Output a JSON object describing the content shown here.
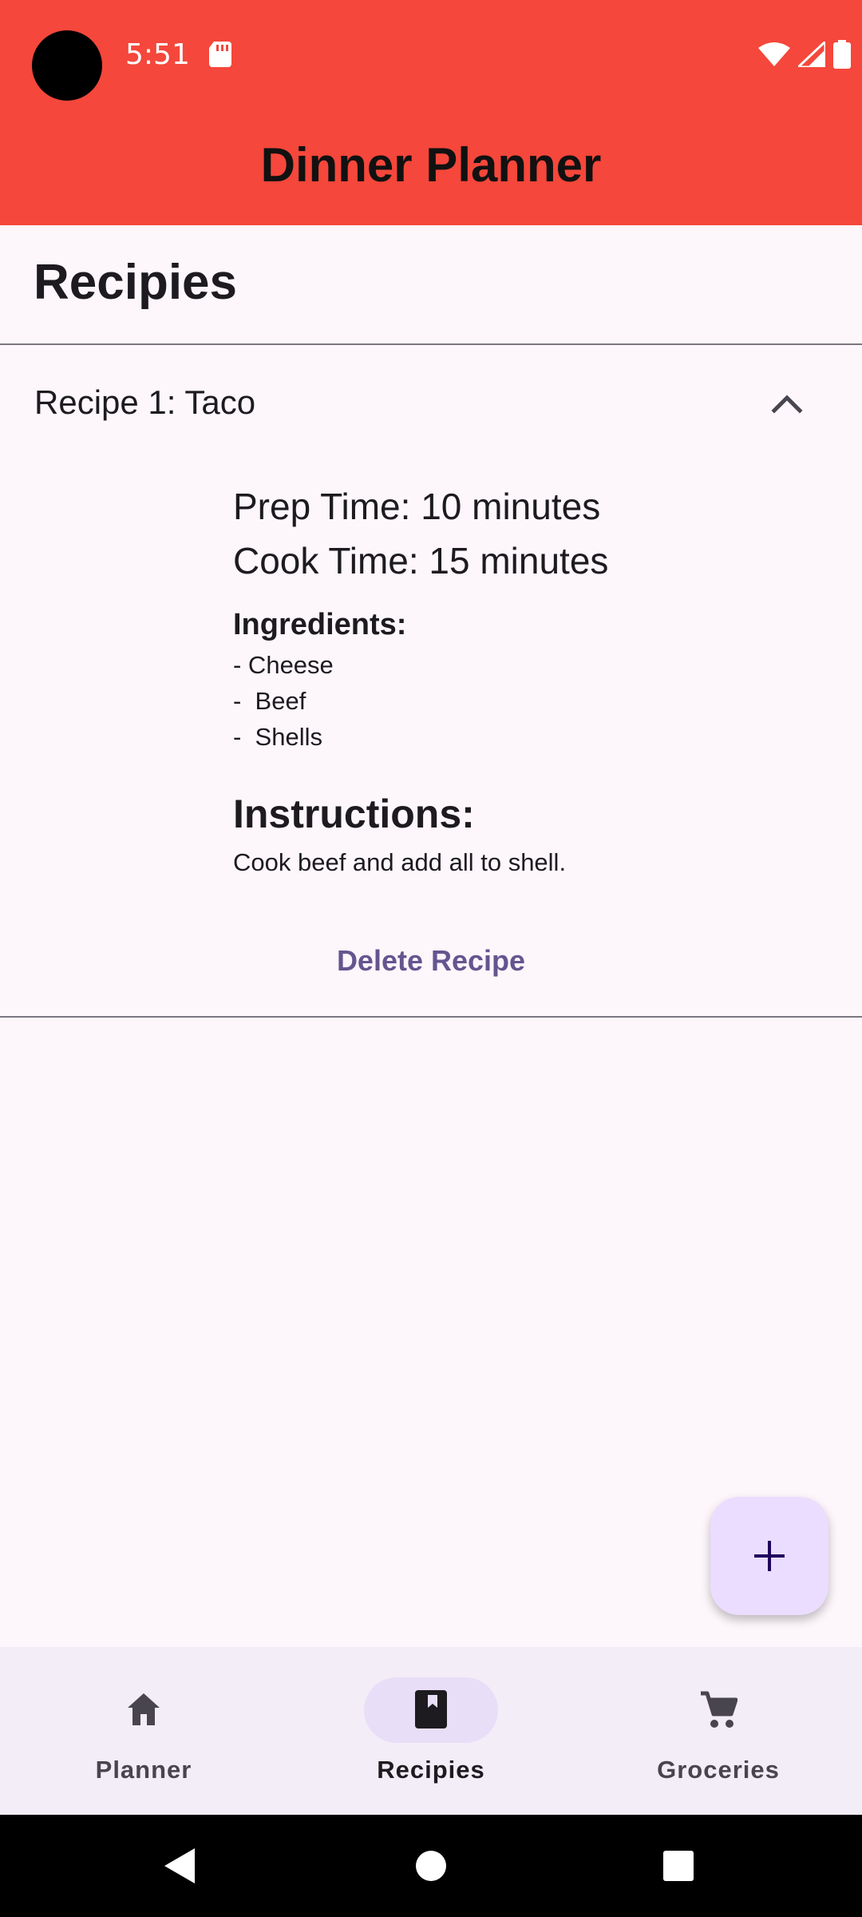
{
  "status_bar": {
    "time": "5:51"
  },
  "app_bar": {
    "title": "Dinner Planner"
  },
  "section": {
    "title": "Recipies"
  },
  "recipe": {
    "title": "Recipe 1: Taco",
    "prep_time": "Prep Time: 10 minutes",
    "cook_time": "Cook Time: 15 minutes",
    "ingredients_label": "Ingredients:",
    "ingredients": [
      "- Cheese",
      "-  Beef",
      "-  Shells"
    ],
    "instructions_label": "Instructions:",
    "instructions": "Cook beef and add all to shell.",
    "delete_label": "Delete Recipe"
  },
  "nav": {
    "items": [
      {
        "label": "Planner",
        "icon": "home-icon",
        "active": false
      },
      {
        "label": "Recipies",
        "icon": "bookmark-book-icon",
        "active": true
      },
      {
        "label": "Groceries",
        "icon": "cart-icon",
        "active": false
      }
    ]
  },
  "colors": {
    "app_bar": "#f5473b",
    "accent": "#65558f",
    "fab": "#eaddff",
    "nav_active_pill": "#e8def8",
    "background": "#fdf7fc"
  }
}
